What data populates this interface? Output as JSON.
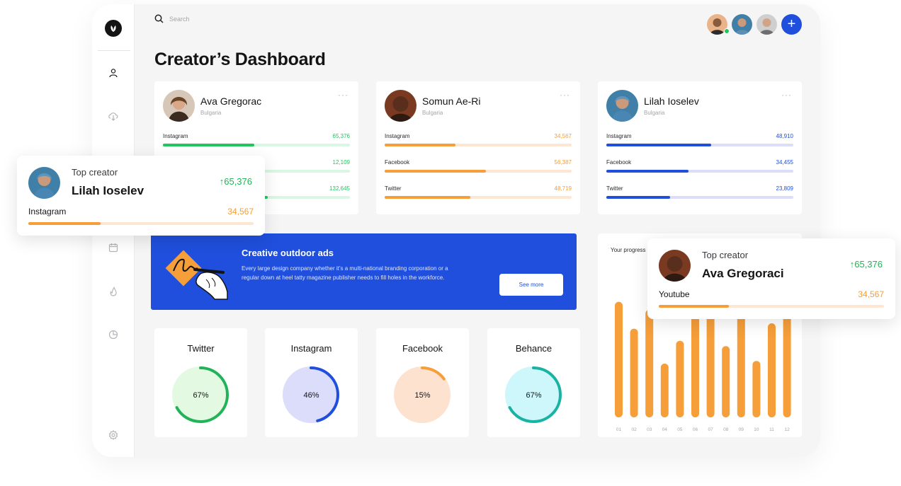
{
  "search": {
    "placeholder": "Search"
  },
  "page": {
    "title": "Creator’s Dashboard"
  },
  "creators": [
    {
      "name": "Ava Gregorac",
      "country": "Bulgaria",
      "accent": "#22c55e",
      "track": "#d9f7e3",
      "metrics": [
        {
          "label": "Instagram",
          "value": "65,376",
          "progress": 0.49
        },
        {
          "label": "",
          "value": "12,109",
          "progress": 0.32
        },
        {
          "label": "",
          "value": "132,645",
          "progress": 0.56
        }
      ]
    },
    {
      "name": "Somun Ae-Ri",
      "country": "Bulgaria",
      "accent": "#f59e3a",
      "track": "#fde7d2",
      "metrics": [
        {
          "label": "Instagram",
          "value": "34,567",
          "progress": 0.38
        },
        {
          "label": "Facebook",
          "value": "56,387",
          "progress": 0.54
        },
        {
          "label": "Twitter",
          "value": "48,719",
          "progress": 0.46
        }
      ]
    },
    {
      "name": "Lilah Ioselev",
      "country": "Bulgaria",
      "accent": "#1f4fdc",
      "track": "#dcdcfb",
      "metrics": [
        {
          "label": "Instagram",
          "value": "48,910",
          "progress": 0.56
        },
        {
          "label": "Facebook",
          "value": "34,455",
          "progress": 0.44
        },
        {
          "label": "Twitter",
          "value": "23,809",
          "progress": 0.34
        }
      ]
    }
  ],
  "banner": {
    "title": "Creative outdoor ads",
    "text": "Every large design company whether it’s a multi-national branding corporation or a regular down at heel tatty magazine publisher needs to fill holes in the workforce.",
    "button": "See more"
  },
  "donuts": [
    {
      "title": "Twitter",
      "value_label": "67%",
      "fraction": 0.67,
      "color": "#22b35a",
      "bg": "#e3f9e1"
    },
    {
      "title": "Instagram",
      "value_label": "46%",
      "fraction": 0.46,
      "color": "#1f4fdc",
      "bg": "#dcdcfb"
    },
    {
      "title": "Facebook",
      "value_label": "15%",
      "fraction": 0.15,
      "color": "#f59e3a",
      "bg": "#fde2cf"
    },
    {
      "title": "Behance",
      "value_label": "67%",
      "fraction": 0.67,
      "color": "#17b3a3",
      "bg": "#cdf7fa"
    }
  ],
  "progress_panel": {
    "title": "Your progress"
  },
  "chart_data": {
    "type": "bar",
    "categories": [
      "01",
      "02",
      "03",
      "04",
      "05",
      "06",
      "07",
      "08",
      "09",
      "10",
      "11",
      "12"
    ],
    "values": [
      86,
      66,
      80,
      40,
      57,
      86,
      86,
      53,
      86,
      42,
      70,
      86
    ],
    "ylim": [
      0,
      100
    ],
    "color": "#f59e3a",
    "grid": false
  },
  "float_cards": [
    {
      "label": "Top creator",
      "name": "Lilah Ioselev",
      "count": "65,376",
      "metric": "Instagram",
      "metric_value": "34,567",
      "progress": 0.32
    },
    {
      "label": "Top creator",
      "name": "Ava Gregoraci",
      "count": "65,376",
      "metric": "Youtube",
      "metric_value": "34,567",
      "progress": 0.31
    }
  ],
  "icons": {
    "up_arrow": "↑",
    "more": "···",
    "plus": "+"
  }
}
